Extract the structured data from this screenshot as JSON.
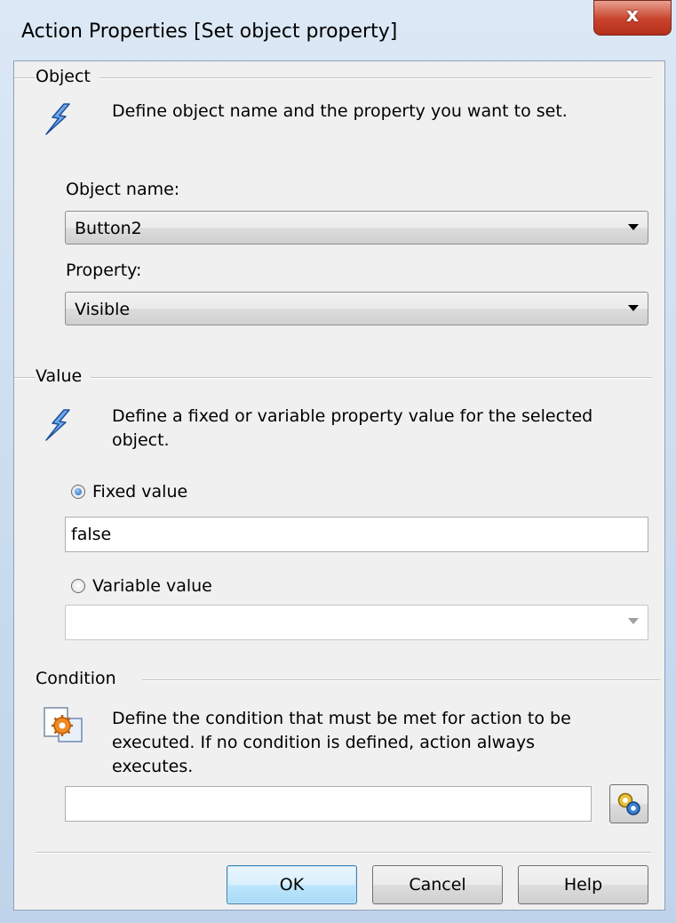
{
  "window": {
    "title": "Action Properties [Set object property]",
    "close_label": "x"
  },
  "object_group": {
    "header": "Object",
    "description": "Define object name and the property you want to set.",
    "object_name_label": "Object name:",
    "object_name_value": "Button2",
    "property_label": "Property:",
    "property_value": "Visible"
  },
  "value_group": {
    "header": "Value",
    "description_line1": "Define a fixed or variable property value for the selected",
    "description_line2": "object.",
    "fixed_label": "Fixed value",
    "fixed_selected": true,
    "fixed_value": "false",
    "variable_label": "Variable value",
    "variable_selected": false,
    "variable_value": ""
  },
  "condition_group": {
    "header": "Condition",
    "description_line1": "Define the condition that must be met for action to be",
    "description_line2": "executed. If no condition is defined, action always",
    "description_line3": "executes.",
    "condition_value": ""
  },
  "buttons": {
    "ok": "OK",
    "cancel": "Cancel",
    "help": "Help"
  },
  "icons": [
    "lightning-icon",
    "condition-gear-document-icon",
    "gear-settings-icon",
    "radio-selected",
    "dropdown-arrow"
  ]
}
